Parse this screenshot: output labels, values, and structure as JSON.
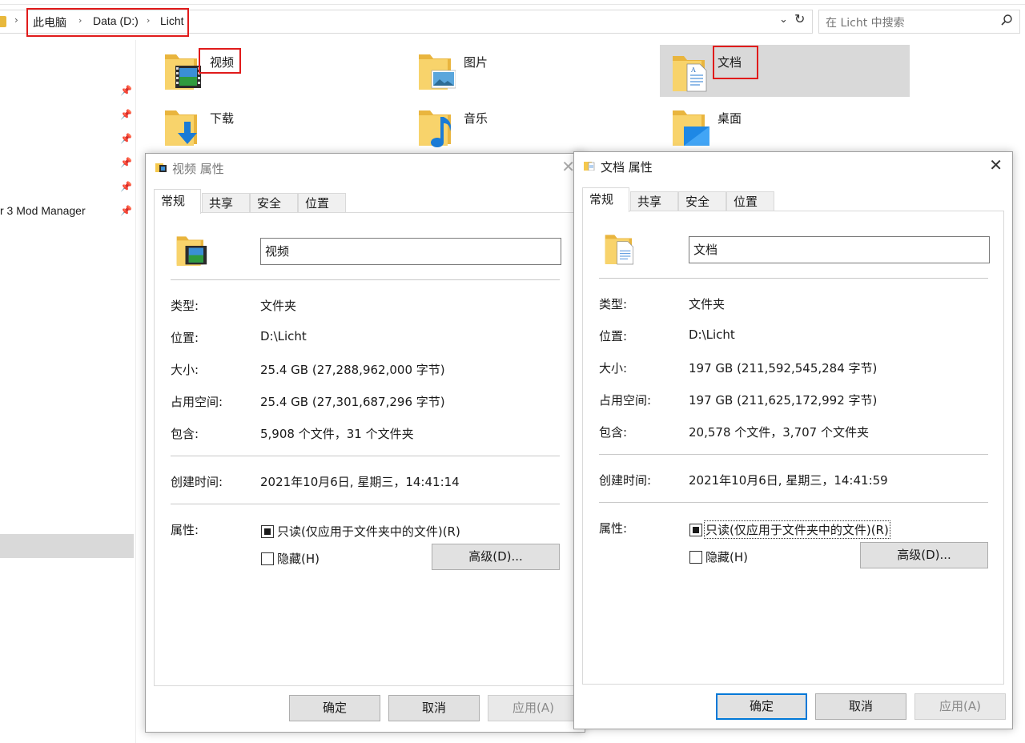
{
  "address": {
    "crumbs": [
      "此电脑",
      "Data (D:)",
      "Licht"
    ],
    "search_placeholder": "在 Licht 中搜索"
  },
  "nav": {
    "partial_item": "r 3 Mod Manager"
  },
  "folders": [
    {
      "label": "视频",
      "icon": "video-folder-icon"
    },
    {
      "label": "图片",
      "icon": "pictures-folder-icon"
    },
    {
      "label": "文档",
      "icon": "documents-folder-icon"
    },
    {
      "label": "下载",
      "icon": "downloads-folder-icon"
    },
    {
      "label": "音乐",
      "icon": "music-folder-icon"
    },
    {
      "label": "桌面",
      "icon": "desktop-folder-icon"
    }
  ],
  "dialog_video": {
    "title": "视频 属性",
    "tabs": [
      "常规",
      "共享",
      "安全",
      "位置"
    ],
    "name": "视频",
    "labels": {
      "type": "类型:",
      "location": "位置:",
      "size": "大小:",
      "size_on_disk": "占用空间:",
      "contains": "包含:",
      "created": "创建时间:",
      "attributes": "属性:"
    },
    "values": {
      "type": "文件夹",
      "location": "D:\\Licht",
      "size": "25.4 GB (27,288,962,000 字节)",
      "size_on_disk": "25.4 GB (27,301,687,296 字节)",
      "contains": "5,908 个文件，31 个文件夹",
      "created": "2021年10月6日, 星期三，14:41:14"
    },
    "readonly_label": "只读(仅应用于文件夹中的文件)(R)",
    "hidden_label": "隐藏(H)",
    "advanced_label": "高级(D)...",
    "ok_label": "确定",
    "cancel_label": "取消",
    "apply_label": "应用(A)"
  },
  "dialog_docs": {
    "title": "文档 属性",
    "tabs": [
      "常规",
      "共享",
      "安全",
      "位置"
    ],
    "name": "文档",
    "labels": {
      "type": "类型:",
      "location": "位置:",
      "size": "大小:",
      "size_on_disk": "占用空间:",
      "contains": "包含:",
      "created": "创建时间:",
      "attributes": "属性:"
    },
    "values": {
      "type": "文件夹",
      "location": "D:\\Licht",
      "size": "197 GB (211,592,545,284 字节)",
      "size_on_disk": "197 GB (211,625,172,992 字节)",
      "contains": "20,578 个文件，3,707 个文件夹",
      "created": "2021年10月6日, 星期三，14:41:59"
    },
    "readonly_label": "只读(仅应用于文件夹中的文件)(R)",
    "hidden_label": "隐藏(H)",
    "advanced_label": "高级(D)...",
    "ok_label": "确定",
    "cancel_label": "取消",
    "apply_label": "应用(A)"
  },
  "colors": {
    "highlight_red": "#e01b1b",
    "selection_gray": "#d9d9d9",
    "folder_yellow": "#f5c84c",
    "accent_blue": "#0078d7"
  }
}
